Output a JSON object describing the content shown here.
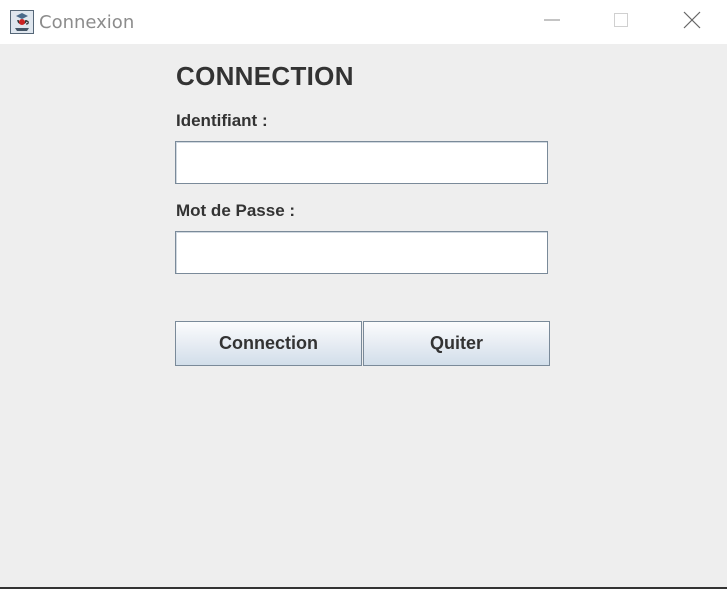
{
  "window": {
    "title": "Connexion",
    "app_icon": "java-coffee-cup-icon",
    "controls": [
      "minimize-icon",
      "maximize-icon",
      "close-icon"
    ]
  },
  "form": {
    "heading": "CONNECTION",
    "username_label": "Identifiant :",
    "username_value": "",
    "password_label": "Mot de Passe :",
    "password_value": "",
    "connect_label": "Connection",
    "quit_label": "Quiter"
  },
  "colors": {
    "background": "#eeeeee",
    "text": "#333333",
    "button_gradient_top": "#fbfcfd",
    "button_gradient_bottom": "#d2deea",
    "border": "#7a8a99"
  }
}
